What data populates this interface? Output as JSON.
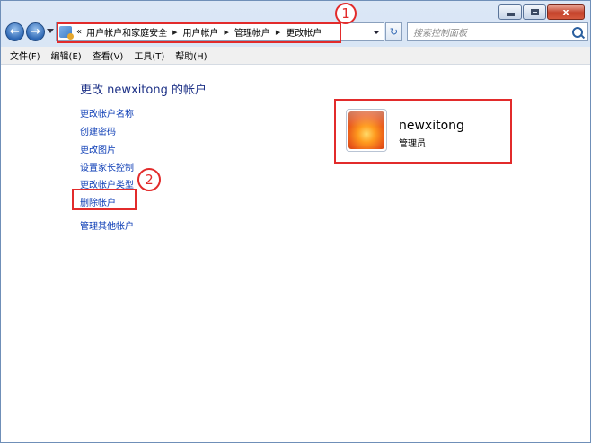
{
  "window": {
    "min_label": "",
    "max_label": "",
    "close_label": "x"
  },
  "nav": {
    "back_glyph": "←",
    "forward_glyph": "→",
    "refresh_glyph": "↻"
  },
  "address": {
    "overflow": "«",
    "crumbs": [
      "用户帐户和家庭安全",
      "用户帐户",
      "管理帐户",
      "更改帐户"
    ]
  },
  "search": {
    "placeholder": "搜索控制面板"
  },
  "menu": [
    "文件(F)",
    "编辑(E)",
    "查看(V)",
    "工具(T)",
    "帮助(H)"
  ],
  "page": {
    "title": "更改 newxitong 的帐户",
    "links": [
      "更改帐户名称",
      "创建密码",
      "更改图片",
      "设置家长控制",
      "更改帐户类型",
      "删除帐户",
      "管理其他帐户"
    ]
  },
  "account": {
    "name": "newxitong",
    "role": "管理员"
  },
  "annotations": {
    "one": "1",
    "two": "2"
  },
  "colors": {
    "highlight": "#e22b2b",
    "link": "#0a3bb5",
    "title": "#1e3287"
  }
}
